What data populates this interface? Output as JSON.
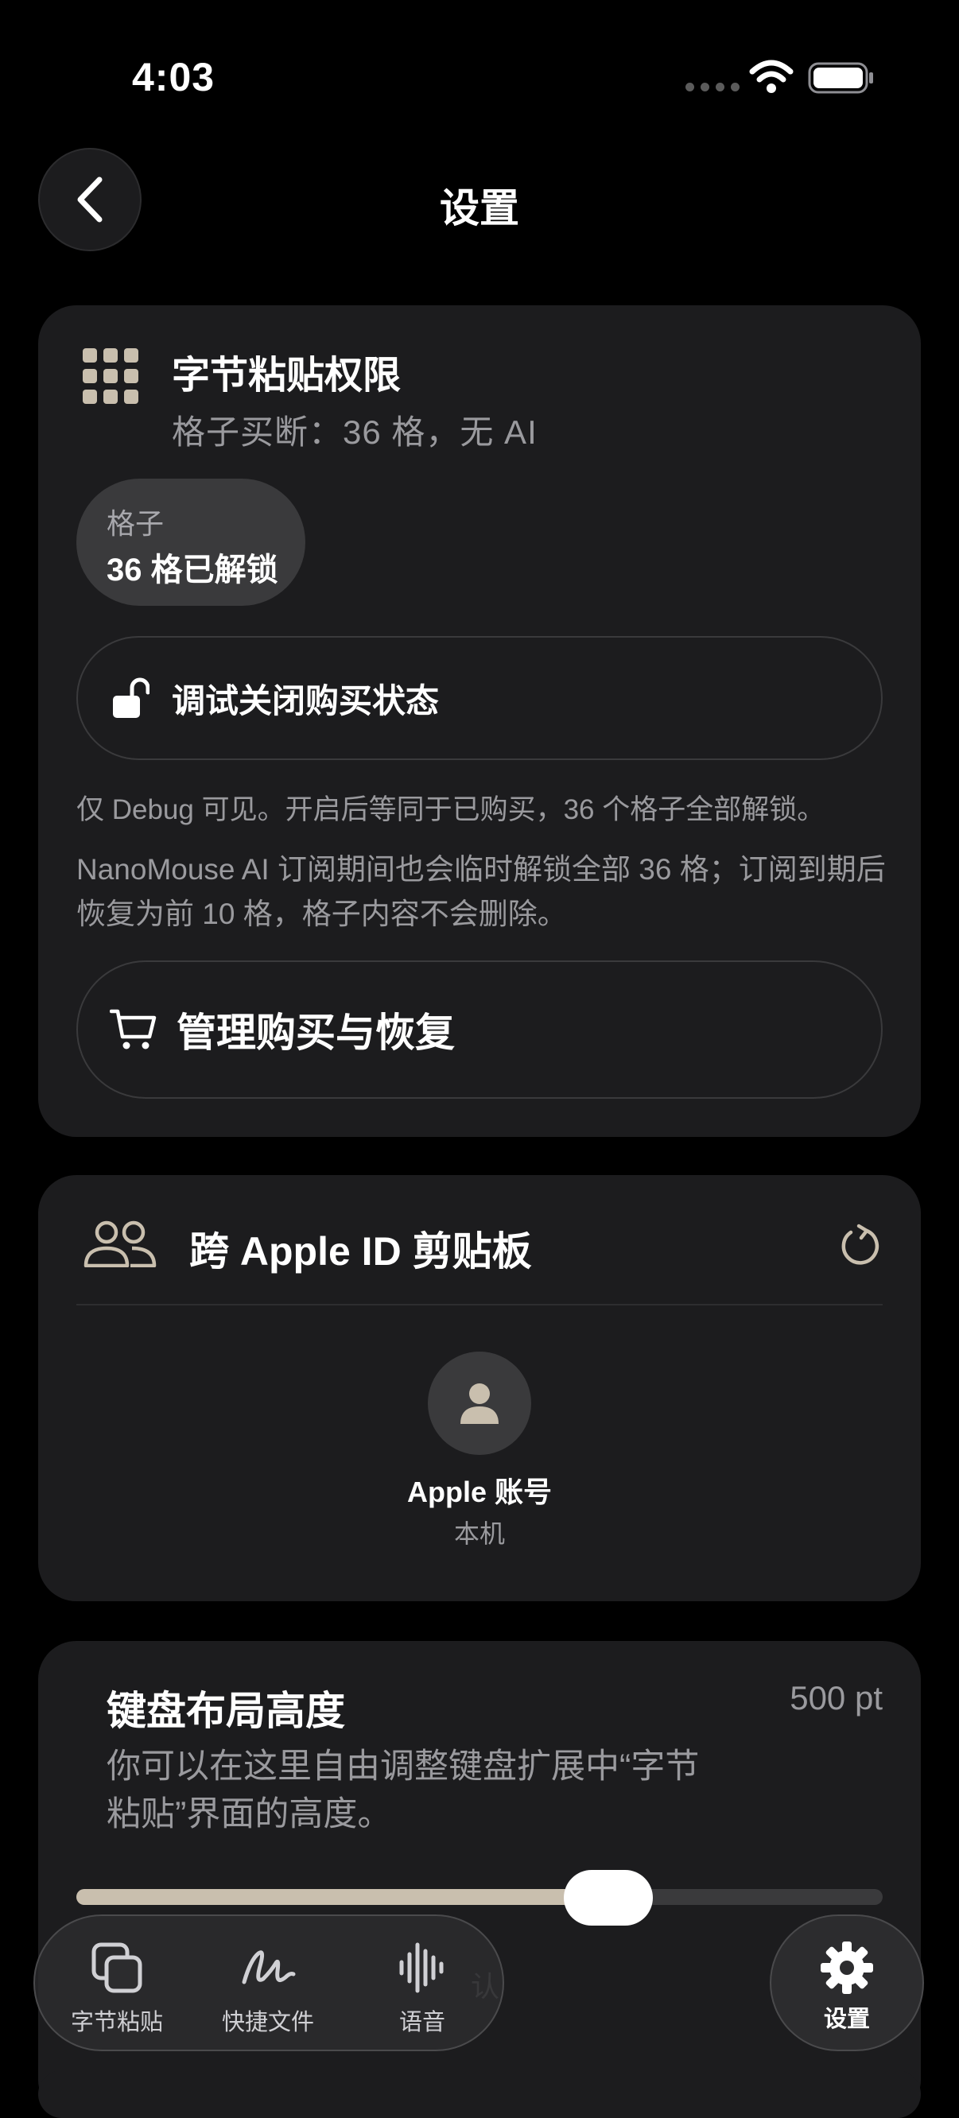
{
  "status_bar": {
    "time": "4:03"
  },
  "header": {
    "title": "设置"
  },
  "permission_card": {
    "title": "字节粘贴权限",
    "subtitle": "格子买断：36 格，无 AI",
    "chip_label": "格子",
    "chip_value": "36 格已解锁",
    "debug_button_label": "调试关闭购买状态",
    "note_debug": "仅 Debug 可见。开启后等同于已购买，36 个格子全部解锁。",
    "note_subscription": "NanoMouse AI 订阅期间也会临时解锁全部 36 格；订阅到期后恢复为前 10 格，格子内容不会删除。",
    "manage_button_label": "管理购买与恢复"
  },
  "cross_id_card": {
    "title": "跨 Apple ID 剪贴板",
    "account_name": "Apple 账号",
    "account_sub": "本机"
  },
  "keyboard_card": {
    "title": "键盘布局高度",
    "value": "500 pt",
    "description": "你可以在这里自由调整键盘扩展中“字节粘贴”界面的高度。",
    "slider_fraction": 0.66,
    "hint_partial": "认"
  },
  "tabbar": {
    "tabs": [
      {
        "label": "字节粘贴",
        "icon": "copy-icon"
      },
      {
        "label": "快捷文件",
        "icon": "signature-icon"
      },
      {
        "label": "语音",
        "icon": "waveform-icon"
      }
    ],
    "settings_label": "设置"
  },
  "colors": {
    "background": "#000000",
    "card": "#1c1c1e",
    "accent_beige": "#c9bfae"
  }
}
